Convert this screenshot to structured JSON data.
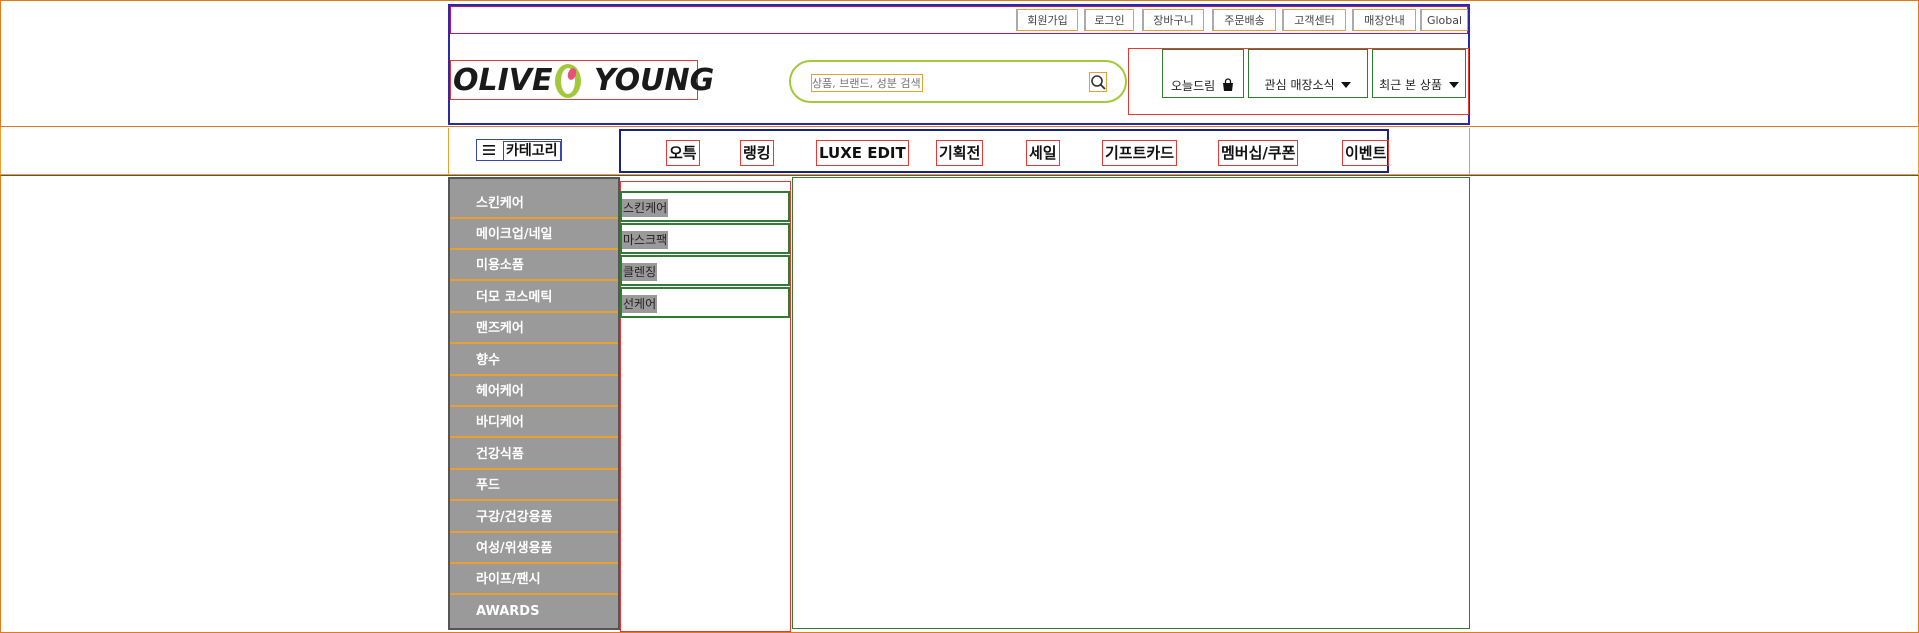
{
  "header": {
    "util_links": [
      "회원가입",
      "로그인",
      "장바구니",
      "주문배송",
      "고객센터",
      "매장안내",
      "Global"
    ],
    "logo": {
      "left": "OLIVE",
      "right": "YOUNG"
    },
    "search": {
      "placeholder": "상품, 브랜드, 성분 검색",
      "icon": "search-icon"
    },
    "right_buttons": [
      {
        "label": "오늘드림",
        "icon": "shopping-bag-icon"
      },
      {
        "label": "관심 매장소식",
        "icon": "caret-down-icon"
      },
      {
        "label": "최근 본 상품",
        "icon": "caret-down-icon"
      }
    ]
  },
  "gnb": {
    "category_label": "카테고리",
    "menu_icon": "hamburger-icon",
    "items": [
      "오특",
      "랭킹",
      "LUXE EDIT",
      "기획전",
      "세일",
      "기프트카드",
      "멤버십/쿠폰",
      "이벤트"
    ]
  },
  "categories": [
    "스킨케어",
    "메이크업/네일",
    "미용소품",
    "더모 코스메틱",
    "맨즈케어",
    "향수",
    "헤어케어",
    "바디케어",
    "건강식품",
    "푸드",
    "구강/건강용품",
    "여성/위생용품",
    "라이프/팬시",
    "AWARDS"
  ],
  "subcategories": [
    "스킨케어",
    "마스크팩",
    "클렌징",
    "선케어"
  ],
  "colors": {
    "brand_green": "#a4c83b",
    "logo_red": "#e8527a",
    "sidebar_gray": "#9a9a9a"
  }
}
